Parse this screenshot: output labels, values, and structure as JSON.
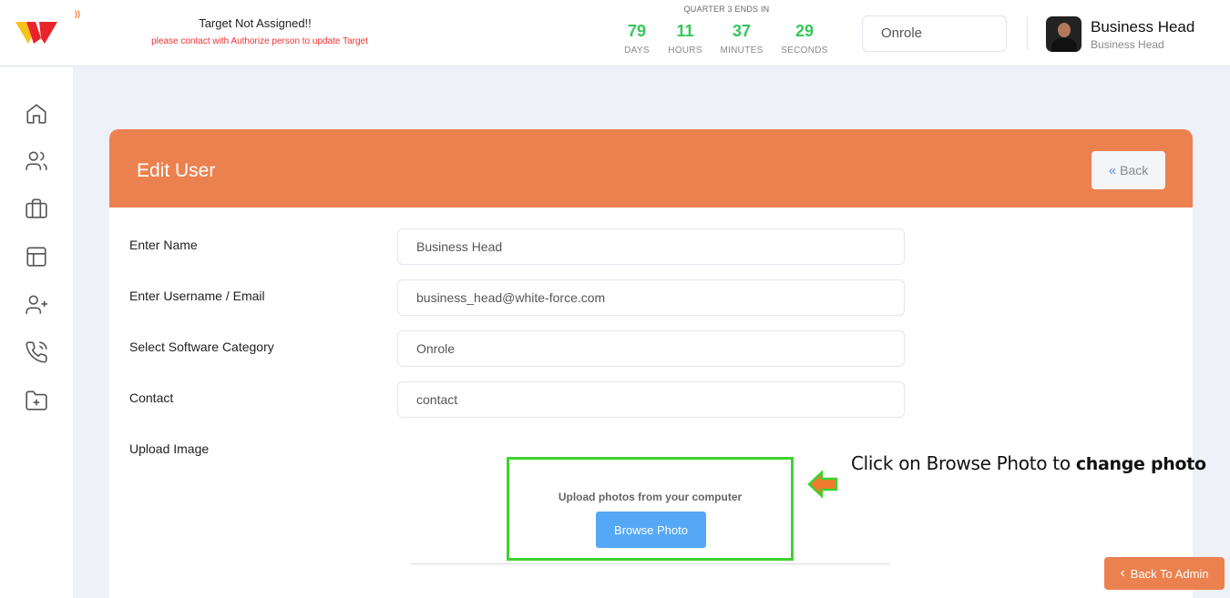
{
  "header": {
    "target_title": "Target Not Assigned!!",
    "target_sub": "please contact with Authorize person to update Target",
    "quarter_label": "QUARTER 3 ENDS IN",
    "countdown": [
      {
        "value": "79",
        "unit": "DAYS"
      },
      {
        "value": "11",
        "unit": "HOURS"
      },
      {
        "value": "37",
        "unit": "MINUTES"
      },
      {
        "value": "29",
        "unit": "SECONDS"
      }
    ],
    "category_value": "Onrole",
    "user": {
      "name": "Business Head",
      "role": "Business Head"
    }
  },
  "sidebar": {
    "icons": [
      "home-icon",
      "users-icon",
      "briefcase-icon",
      "layout-icon",
      "user-plus-icon",
      "phone-call-icon",
      "folder-plus-icon"
    ]
  },
  "card": {
    "title": "Edit User",
    "back_label": "Back"
  },
  "form": {
    "fields": [
      {
        "label": "Enter Name",
        "value": "Business Head"
      },
      {
        "label": "Enter Username / Email",
        "value": "business_head@white-force.com"
      },
      {
        "label": "Select Software Category",
        "value": "Onrole"
      },
      {
        "label": "Contact",
        "placeholder": "contact"
      }
    ],
    "upload_label": "Upload Image",
    "upload_text": "Upload photos from your computer",
    "browse_label": "Browse Photo"
  },
  "annotation": {
    "text": "Click on Browse Photo to",
    "bold": "change photo"
  },
  "footer": {
    "back_admin_label": "Back To Admin"
  },
  "colors": {
    "accent": "#ec8150",
    "countdown": "#34c759",
    "browse": "#55a8f5",
    "highlight": "#3ed22f",
    "alert": "#ee3333"
  }
}
